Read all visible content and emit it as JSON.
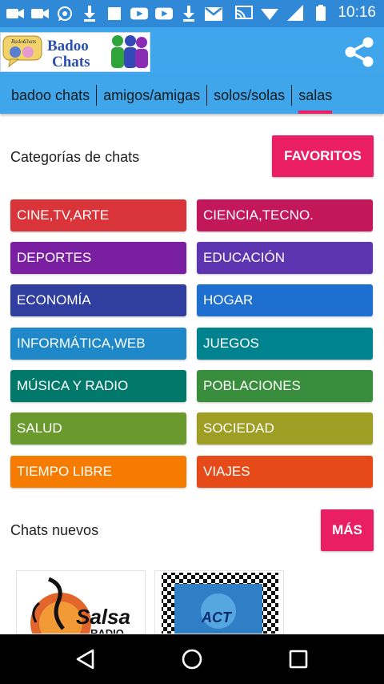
{
  "status_bar": {
    "time": "10:16",
    "icons": [
      "video-icon",
      "video-icon",
      "whatsapp-icon",
      "download-icon",
      "square-icon",
      "youtube-icon",
      "youtube-icon",
      "download-icon",
      "gmail-icon",
      "cast-icon",
      "wifi-icon",
      "signal-icon",
      "battery-icon"
    ]
  },
  "app_bar": {
    "logo_text_line1": "Badoo",
    "logo_text_line2": "Chats",
    "logo_small": "Badoo Chats"
  },
  "tabs": [
    {
      "label": "badoo chats"
    },
    {
      "label": "amigos/amigas"
    },
    {
      "label": "solos/solas"
    },
    {
      "label": "salas",
      "active": true
    }
  ],
  "categories_section": {
    "title": "Categorías de chats",
    "button": "FAVORITOS",
    "items": [
      {
        "label": "CINE,TV,ARTE",
        "color": "#d8343a"
      },
      {
        "label": "CIENCIA,TECNO.",
        "color": "#c2185b"
      },
      {
        "label": "DEPORTES",
        "color": "#7b1fa2"
      },
      {
        "label": "EDUCACIÓN",
        "color": "#5e35b1"
      },
      {
        "label": "ECONOMÍA",
        "color": "#303f9f"
      },
      {
        "label": "HOGAR",
        "color": "#1e6fd0"
      },
      {
        "label": "INFORMÁTICA,WEB",
        "color": "#1e88c9"
      },
      {
        "label": "JUEGOS",
        "color": "#00838f"
      },
      {
        "label": "MÚSICA Y RADIO",
        "color": "#00796b"
      },
      {
        "label": "POBLACIONES",
        "color": "#388e3c"
      },
      {
        "label": "SALUD",
        "color": "#6a9a2e"
      },
      {
        "label": "SOCIEDAD",
        "color": "#9e9d24"
      },
      {
        "label": "TIEMPO LIBRE",
        "color": "#f57c00"
      },
      {
        "label": "VIAJES",
        "color": "#e64a19"
      }
    ]
  },
  "new_chats_section": {
    "title": "Chats nuevos",
    "button": "MÁS",
    "thumbs": [
      {
        "text_line1": "Salsa",
        "text_line2": "RADIO"
      },
      {
        "text": "ACT"
      }
    ]
  },
  "colors": {
    "status_bar": "#2f89d6",
    "app_bar": "#3fa6ec",
    "accent": "#e91e63"
  }
}
